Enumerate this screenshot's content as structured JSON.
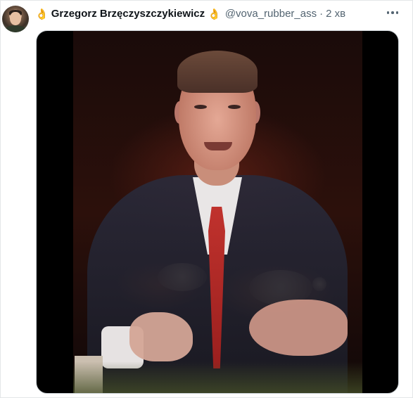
{
  "post": {
    "emoji_left": "👌",
    "author_name": "Grzegorz Brzęczyszczykiewicz",
    "emoji_right": "👌",
    "handle": "@vova_rubber_ass",
    "separator": "·",
    "timestamp": "2 хв"
  },
  "media": {
    "type": "video",
    "subject": "man in suit and red tie speaking in front of fire"
  },
  "colors": {
    "text_primary": "#0f1419",
    "text_secondary": "#536471",
    "media_background": "#000000"
  },
  "icons": [
    "avatar",
    "more-options-icon"
  ]
}
